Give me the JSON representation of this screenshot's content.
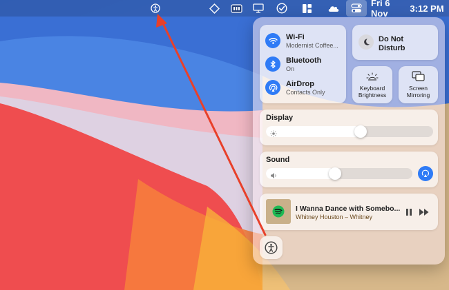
{
  "menubar": {
    "date": "Fri 6 Nov",
    "time": "3:12 PM",
    "icons": [
      "accessibility-shortcut-icon",
      "rotate-diamond-icon",
      "battery-meter-icon",
      "display-icon",
      "checkmark-circle-icon",
      "grid-icon",
      "cloud-icon",
      "control-center-icon"
    ]
  },
  "control_center": {
    "wifi": {
      "title": "Wi-Fi",
      "subtitle": "Modernist Coffee..."
    },
    "bluetooth": {
      "title": "Bluetooth",
      "subtitle": "On"
    },
    "airdrop": {
      "title": "AirDrop",
      "subtitle": "Contacts Only"
    },
    "do_not_disturb": {
      "title": "Do Not\nDisturb",
      "line1": "Do Not",
      "line2": "Disturb"
    },
    "keyboard_brightness": {
      "line1": "Keyboard",
      "line2": "Brightness"
    },
    "screen_mirroring": {
      "line1": "Screen",
      "line2": "Mirroring"
    },
    "display": {
      "title": "Display",
      "level": 0.53
    },
    "sound": {
      "title": "Sound",
      "level": 0.43
    },
    "now_playing": {
      "track": "I Wanna Dance with Somebo...",
      "artist": "Whitney Houston – Whitney"
    }
  },
  "colors": {
    "accent": "#2f7bf6",
    "spotify": "#1db954",
    "arrow": "#e8402a"
  }
}
